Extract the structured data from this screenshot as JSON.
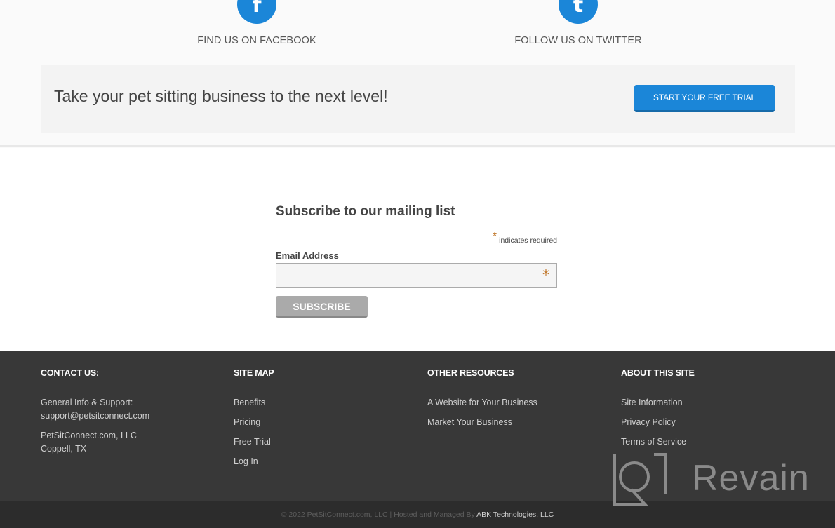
{
  "social": {
    "facebook": {
      "icon": "facebook-icon",
      "glyph": "f",
      "label": "FIND US ON FACEBOOK"
    },
    "twitter": {
      "icon": "twitter-icon",
      "glyph": "t",
      "label": "FOLLOW US ON TWITTER"
    }
  },
  "cta": {
    "text": "Take your pet sitting business to the next level!",
    "button_label": "START YOUR FREE TRIAL"
  },
  "subscribe": {
    "title": "Subscribe to our mailing list",
    "required_marker": "*",
    "required_note": "indicates required",
    "email_label": "Email Address",
    "email_value": "",
    "email_required_marker": "*",
    "button_label": "SUBSCRIBE"
  },
  "footer": {
    "contact": {
      "heading": "CONTACT US:",
      "lines": [
        "General Info & Support:",
        "support@petsitconnect.com",
        "PetSitConnect.com, LLC",
        "Coppell, TX"
      ]
    },
    "sitemap": {
      "heading": "SITE MAP",
      "links": [
        "Benefits",
        "Pricing",
        "Free Trial",
        "Log In"
      ]
    },
    "resources": {
      "heading": "OTHER RESOURCES",
      "links": [
        "A Website for Your Business",
        "Market Your Business"
      ]
    },
    "about": {
      "heading": "ABOUT THIS SITE",
      "links": [
        "Site Information",
        "Privacy Policy",
        "Terms of Service"
      ]
    },
    "copyright": "© 2022 PetSitConnect.com, LLC | Hosted and Managed By",
    "host_link": "ABK Technologies, LLC"
  },
  "watermark": {
    "text": "Revain",
    "icon": "revain-logo-icon"
  },
  "colors": {
    "brand_blue": "#1b86d8",
    "footer_bg": "#383838",
    "required": "#c0772a"
  }
}
